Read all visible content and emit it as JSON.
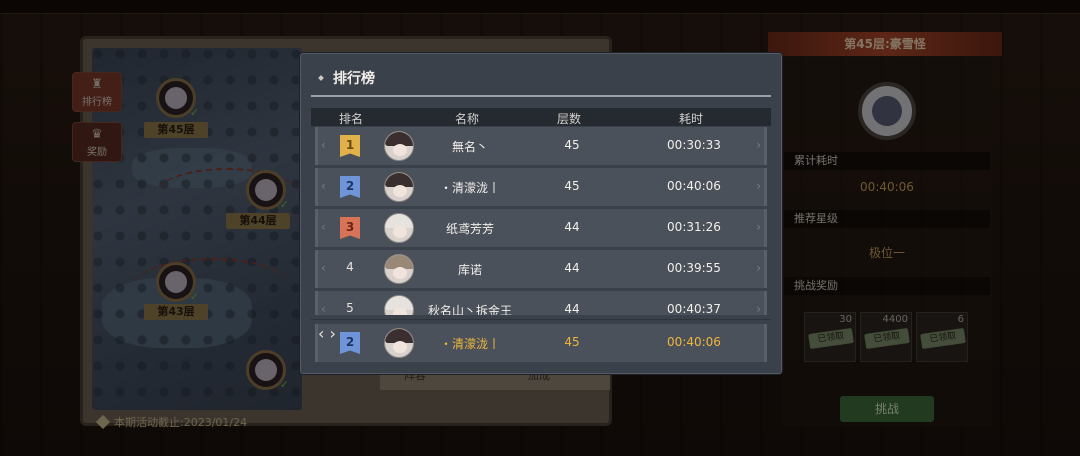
{
  "map": {
    "levels": [
      {
        "label": "第45层",
        "cleared": true
      },
      {
        "label": "第44层",
        "cleared": true
      },
      {
        "label": "第43层",
        "cleared": true
      }
    ],
    "side_buttons": [
      {
        "label": "排行榜",
        "icon": "leaderboard-icon"
      },
      {
        "label": "奖励",
        "icon": "reward-icon"
      }
    ],
    "deadline": "本期活动截止:2023/01/24",
    "bottom_tabs": [
      "阵容",
      "加成"
    ]
  },
  "detail": {
    "title": "第45层:豪雪怪",
    "total_time_label": "累计耗时",
    "total_time_value": "00:40:06",
    "recommended_label": "推荐星级",
    "recommended_value": "极位一",
    "reward_label": "挑战奖励",
    "rewards": [
      {
        "qty": "30",
        "status": "已领取"
      },
      {
        "qty": "4400",
        "status": "已领取"
      },
      {
        "qty": "6",
        "status": "已领取"
      }
    ],
    "challenge_button": "挑战"
  },
  "leaderboard": {
    "title": "排行榜",
    "headers": {
      "rank": "排名",
      "name": "名称",
      "floor": "层数",
      "time": "耗时"
    },
    "rows": [
      {
        "rank": "1",
        "badge": "gold",
        "name": "無名丶",
        "floor": "45",
        "time": "00:30:33",
        "avatar": "dark"
      },
      {
        "rank": "2",
        "badge": "blue",
        "name": "・清濛泷丨",
        "floor": "45",
        "time": "00:40:06",
        "avatar": "dark"
      },
      {
        "rank": "3",
        "badge": "red",
        "name": "纸鸢芳芳",
        "floor": "44",
        "time": "00:31:26",
        "avatar": "light"
      },
      {
        "rank": "4",
        "badge": "none",
        "name": "库诺",
        "floor": "44",
        "time": "00:39:55",
        "avatar": "brown"
      },
      {
        "rank": "5",
        "badge": "none",
        "name": "秋名山丶拆金王",
        "floor": "44",
        "time": "00:40:37",
        "avatar": "light"
      }
    ],
    "my_row": {
      "rank": "2",
      "badge": "blue",
      "name": "・清濛泷丨",
      "floor": "45",
      "time": "00:40:06",
      "avatar": "dark"
    }
  }
}
